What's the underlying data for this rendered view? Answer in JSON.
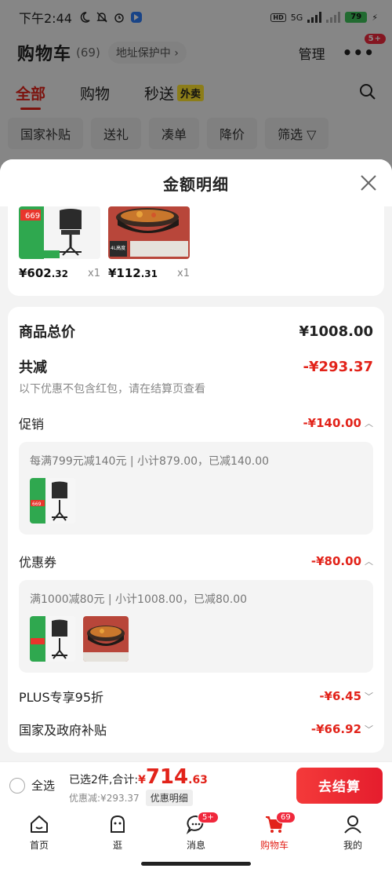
{
  "status_bar": {
    "time": "下午2:44",
    "battery": "79",
    "network": "5G"
  },
  "header": {
    "title": "购物车",
    "count": "(69)",
    "address": "地址保护中 ›",
    "manage": "管理",
    "more_badge": "5+"
  },
  "tabs": [
    {
      "label": "全部",
      "active": true
    },
    {
      "label": "购物",
      "active": false
    },
    {
      "label": "秒送",
      "active": false,
      "tag": "外卖"
    }
  ],
  "chips": [
    "国家补贴",
    "送礼",
    "凑单",
    "降价",
    "筛选 ▽"
  ],
  "sheet": {
    "title": "金额明细",
    "products": [
      {
        "price_int": "¥602",
        "price_dec": ".32",
        "qty": "x1",
        "name": "chair-image"
      },
      {
        "price_int": "¥112",
        "price_dec": ".31",
        "qty": "x1",
        "name": "pot-image"
      }
    ],
    "total_label": "商品总价",
    "total_value": "¥1008.00",
    "reduce_label": "共减",
    "reduce_value": "-¥293.37",
    "reduce_note": "以下优惠不包含红包，请在结算页查看",
    "promo": {
      "label": "促销",
      "value": "-¥140.00",
      "desc": "每满799元减140元 | 小计879.00，已减140.00"
    },
    "coupon": {
      "label": "优惠券",
      "value": "-¥80.00",
      "desc": "满1000减80元 | 小计1008.00，已减80.00"
    },
    "plus": {
      "label": "PLUS专享95折",
      "value": "-¥6.45"
    },
    "subsidy": {
      "label": "国家及政府补贴",
      "value": "-¥66.92"
    },
    "thumb_text": {
      "chair_price": "669",
      "pot_tag": "4L高度"
    }
  },
  "bottom": {
    "select_all": "全选",
    "selected_text": "已选2件,合计:",
    "currency": "¥",
    "amount": "714",
    "amount_dec": ".63",
    "saved": "优惠减:¥293.37",
    "detail_button": "优惠明细",
    "checkout": "去结算"
  },
  "tabbar": [
    {
      "label": "首页",
      "icon": "home-icon"
    },
    {
      "label": "逛",
      "icon": "browse-icon"
    },
    {
      "label": "消息",
      "icon": "message-icon",
      "badge": "5+"
    },
    {
      "label": "购物车",
      "icon": "cart-icon",
      "badge": "69",
      "active": true
    },
    {
      "label": "我的",
      "icon": "profile-icon"
    }
  ],
  "colors": {
    "accent": "#e2231a",
    "checkout": "#f43a3a"
  }
}
